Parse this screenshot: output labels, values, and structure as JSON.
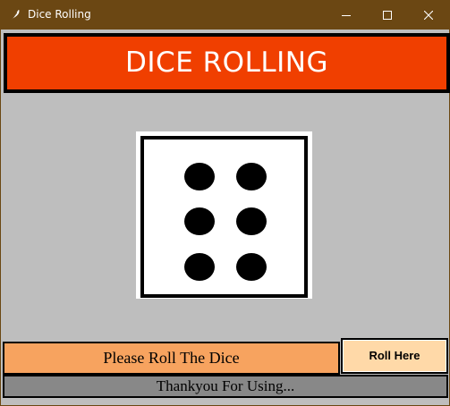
{
  "window": {
    "title": "Dice Rolling",
    "controls": [
      "minimize",
      "maximize",
      "close"
    ]
  },
  "banner": {
    "text": "DICE ROLLING"
  },
  "dice": {
    "face_value": 6,
    "pips_shown": 6
  },
  "status": {
    "text": "Please Roll The Dice"
  },
  "roll_button": {
    "label": "Roll Here"
  },
  "footer": {
    "text": "Thankyou For Using..."
  },
  "colors": {
    "frame": "#6b4713",
    "banner_bg": "#f03f00",
    "client_bg": "#bebebe",
    "status_bg": "#f7a35f",
    "button_bg": "#ffd9a8",
    "footer_bg": "#888888"
  }
}
